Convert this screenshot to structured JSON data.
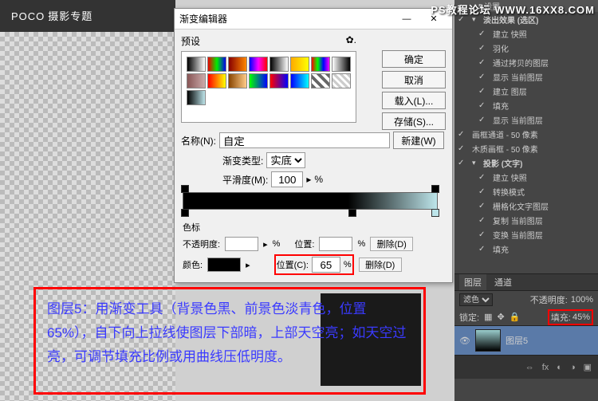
{
  "watermark": "PS教程论坛 WWW.16XX8.COM",
  "logo": {
    "brand": "POCO",
    "sub": "摄影专题"
  },
  "dialog": {
    "title": "渐变编辑器",
    "min": "—",
    "close": "✕",
    "presets_label": "预设",
    "btn_ok": "确定",
    "btn_cancel": "取消",
    "btn_load": "载入(L)...",
    "btn_save": "存储(S)...",
    "btn_new": "新建(W)",
    "name_label": "名称(N):",
    "name_value": "自定",
    "type_label": "渐变类型:",
    "type_value": "实底",
    "smooth_label": "平滑度(M):",
    "smooth_value": "100",
    "percent": "%",
    "stops_header": "色标",
    "opacity_label": "不透明度:",
    "opacity_value": "",
    "location_label": "位置:",
    "location_value": "",
    "delete1": "删除(D)",
    "color_label": "颜色:",
    "location2_label": "位置(C):",
    "location2_value": "65",
    "delete2": "删除(D)"
  },
  "annotation": "图层5：用渐变工具（背景色黑、前景色淡青色，位置65%），自下向上拉线使图层下部暗，上部天空亮；如天空过亮，可调节填充比例或用曲线压低明度。",
  "ps": {
    "top_settings": "设置",
    "layer_items": [
      {
        "type": "group",
        "name": "淡出效果 (选区)"
      },
      {
        "type": "item",
        "name": "建立 快照",
        "indent": 1
      },
      {
        "type": "item",
        "name": "羽化",
        "indent": 1
      },
      {
        "type": "item",
        "name": "通过拷贝的图层",
        "indent": 1
      },
      {
        "type": "item",
        "name": "显示 当前图层",
        "indent": 1
      },
      {
        "type": "item",
        "name": "建立 图层",
        "indent": 1
      },
      {
        "type": "item",
        "name": "填充",
        "indent": 1
      },
      {
        "type": "item",
        "name": "显示 当前图层",
        "indent": 1
      },
      {
        "type": "item",
        "name": "画框通道 - 50 像素"
      },
      {
        "type": "item",
        "name": "木质画框 - 50 像素"
      },
      {
        "type": "group",
        "name": "投影 (文字)"
      },
      {
        "type": "item",
        "name": "建立 快照",
        "indent": 1
      },
      {
        "type": "item",
        "name": "转换模式",
        "indent": 1
      },
      {
        "type": "item",
        "name": "栅格化文字图层",
        "indent": 1
      },
      {
        "type": "item",
        "name": "复制 当前图层",
        "indent": 1
      },
      {
        "type": "item",
        "name": "变换 当前图层",
        "indent": 1
      },
      {
        "type": "item",
        "name": "填充",
        "indent": 1
      }
    ],
    "tabs": {
      "layers": "图层",
      "channels": "通道"
    },
    "mode_label": "滤色",
    "opacity_label": "不透明度:",
    "opacity_value": "100%",
    "lock_label": "锁定:",
    "fill_label": "填充:",
    "fill_value": "45%",
    "layer5_name": "图层5"
  },
  "swatches": [
    "linear-gradient(to right,#000,#fff)",
    "linear-gradient(to right,#e00,#0e0,#00e)",
    "linear-gradient(to right,#800,#f80)",
    "linear-gradient(to right,#00f,#f0f,#f00)",
    "linear-gradient(to right,#000,#fff)",
    "linear-gradient(to right,#fa0,#ff0)",
    "linear-gradient(to right,#f00,#0f0,#00f,#f0f)",
    "linear-gradient(to right,#fff,#000)",
    "linear-gradient(to right,#855,#caa)",
    "linear-gradient(to right,#f00,#ff0)",
    "linear-gradient(to right,#840,#fc8)",
    "linear-gradient(to right,#0f0,#00f)",
    "linear-gradient(to right,#f00,#00f)",
    "linear-gradient(to right,#00f,#0ff)",
    "repeating-linear-gradient(45deg,#666 0 4px,#fff 4px 8px)",
    "repeating-linear-gradient(45deg,#ccc 0 3px,#fff 3px 6px)",
    "linear-gradient(to right,#000,#bde5ea)"
  ]
}
